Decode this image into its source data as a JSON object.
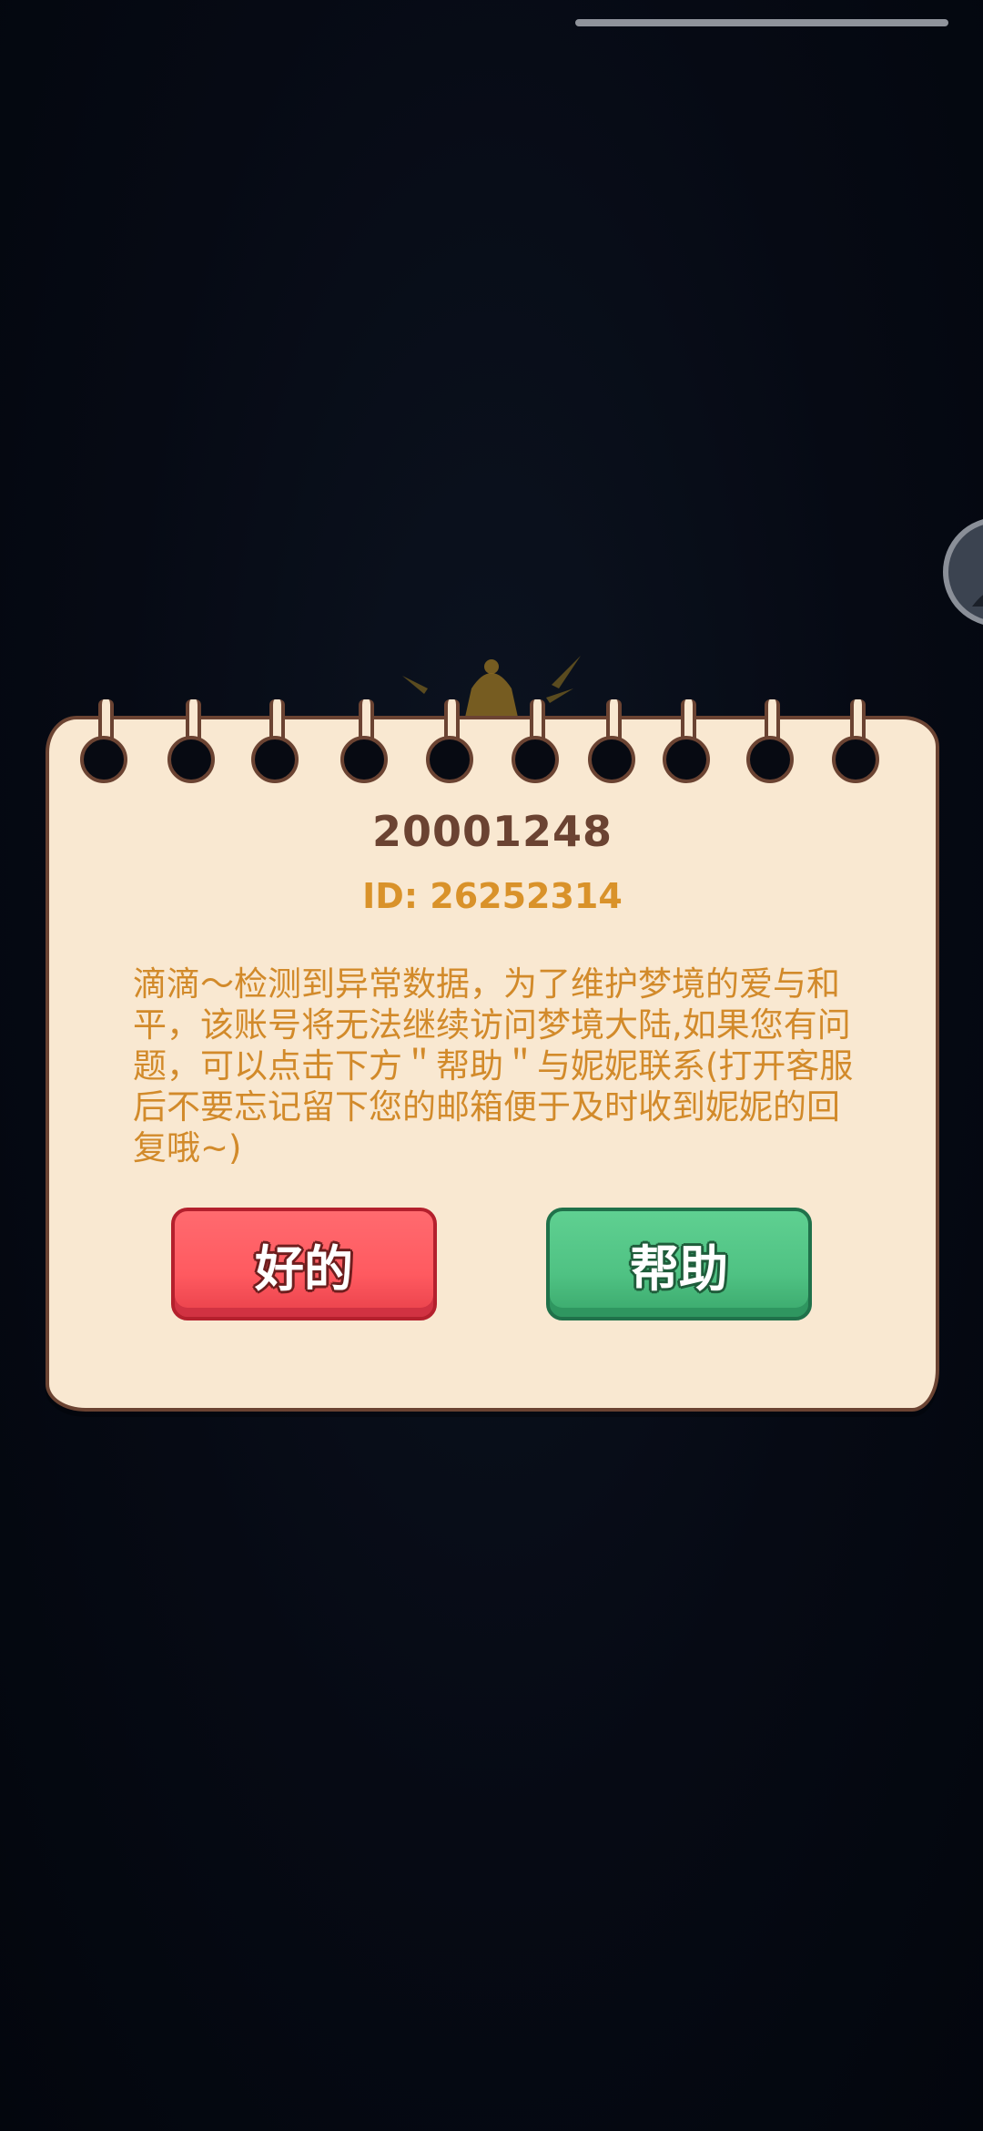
{
  "dialog": {
    "username": "20001248",
    "user_id": "ID: 26252314",
    "message": "滴滴～检测到异常数据，为了维护梦境的爱与和平，该账号将无法继续访问梦境大陆,如果您有问题，可以点击下方＂帮助＂与妮妮联系(打开客服后不要忘记留下您的邮箱便于及时收到妮妮的回复哦~)",
    "ok_label": "好的",
    "help_label": "帮助"
  },
  "icons": {
    "bell": "bell-icon",
    "side_avatar": "avatar-icon"
  },
  "colors": {
    "background": "#050914",
    "paper": "#f9e8d1",
    "paper_border": "#6b4332",
    "text_orange": "#d28a2a",
    "ok_button": "#ff5a60",
    "help_button": "#4fc283"
  }
}
